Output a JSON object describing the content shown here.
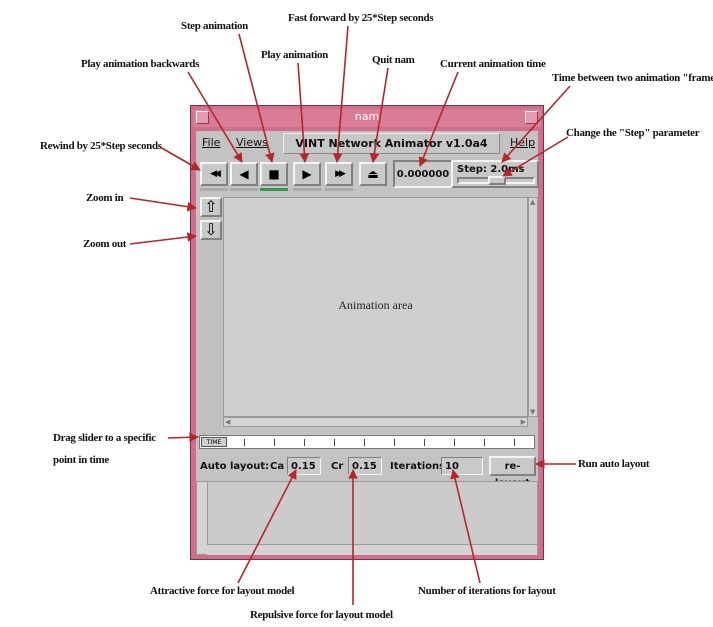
{
  "window": {
    "title": "nam",
    "menu": {
      "file": "File",
      "views": "Views",
      "app_title": "VINT Network Animator v1.0a4",
      "help": "Help"
    },
    "controls": {
      "rewind": "◀◀",
      "play_back": "◀",
      "stop": "■",
      "play": "▶",
      "fast_forward": "▶▶",
      "quit": "⏏",
      "time": "0.000000",
      "step": "Step: 2.0ms"
    },
    "zoom": {
      "in": "⇧",
      "out": "⇩"
    },
    "animation_area_label": "Animation area",
    "timeline_thumb": "TIME",
    "layout": {
      "label": "Auto layout:",
      "ca_label": "Ca",
      "ca_value": "0.15",
      "cr_label": "Cr",
      "cr_value": "0.15",
      "iter_label": "Iterations",
      "iter_value": "10",
      "relayout_button": "re-layout"
    }
  },
  "annotations": {
    "step_animation": "Step animation",
    "fast_forward": "Fast forward by 25*Step seconds",
    "play_backwards": "Play animation backwards",
    "play": "Play animation",
    "quit": "Quit nam",
    "current_time": "Current animation time",
    "time_between": "Time between two animation \"frames\"",
    "change_step": "Change the \"Step\" parameter",
    "rewind": "Rewind by 25*Step seconds",
    "zoom_in": "Zoom in",
    "zoom_out": "Zoom out",
    "drag_slider_1": "Drag slider to a specific",
    "drag_slider_2": "point in time",
    "run_auto_layout": "Run auto layout",
    "attractive": "Attractive force for layout model",
    "repulsive": "Repulsive force for layout model",
    "iterations": "Number of iterations for layout"
  },
  "colors": {
    "window_frame": "#cf6f8b",
    "panel": "#c3c3c3",
    "active_indicator": "#2f9b4a",
    "arrow": "#b3262c"
  }
}
